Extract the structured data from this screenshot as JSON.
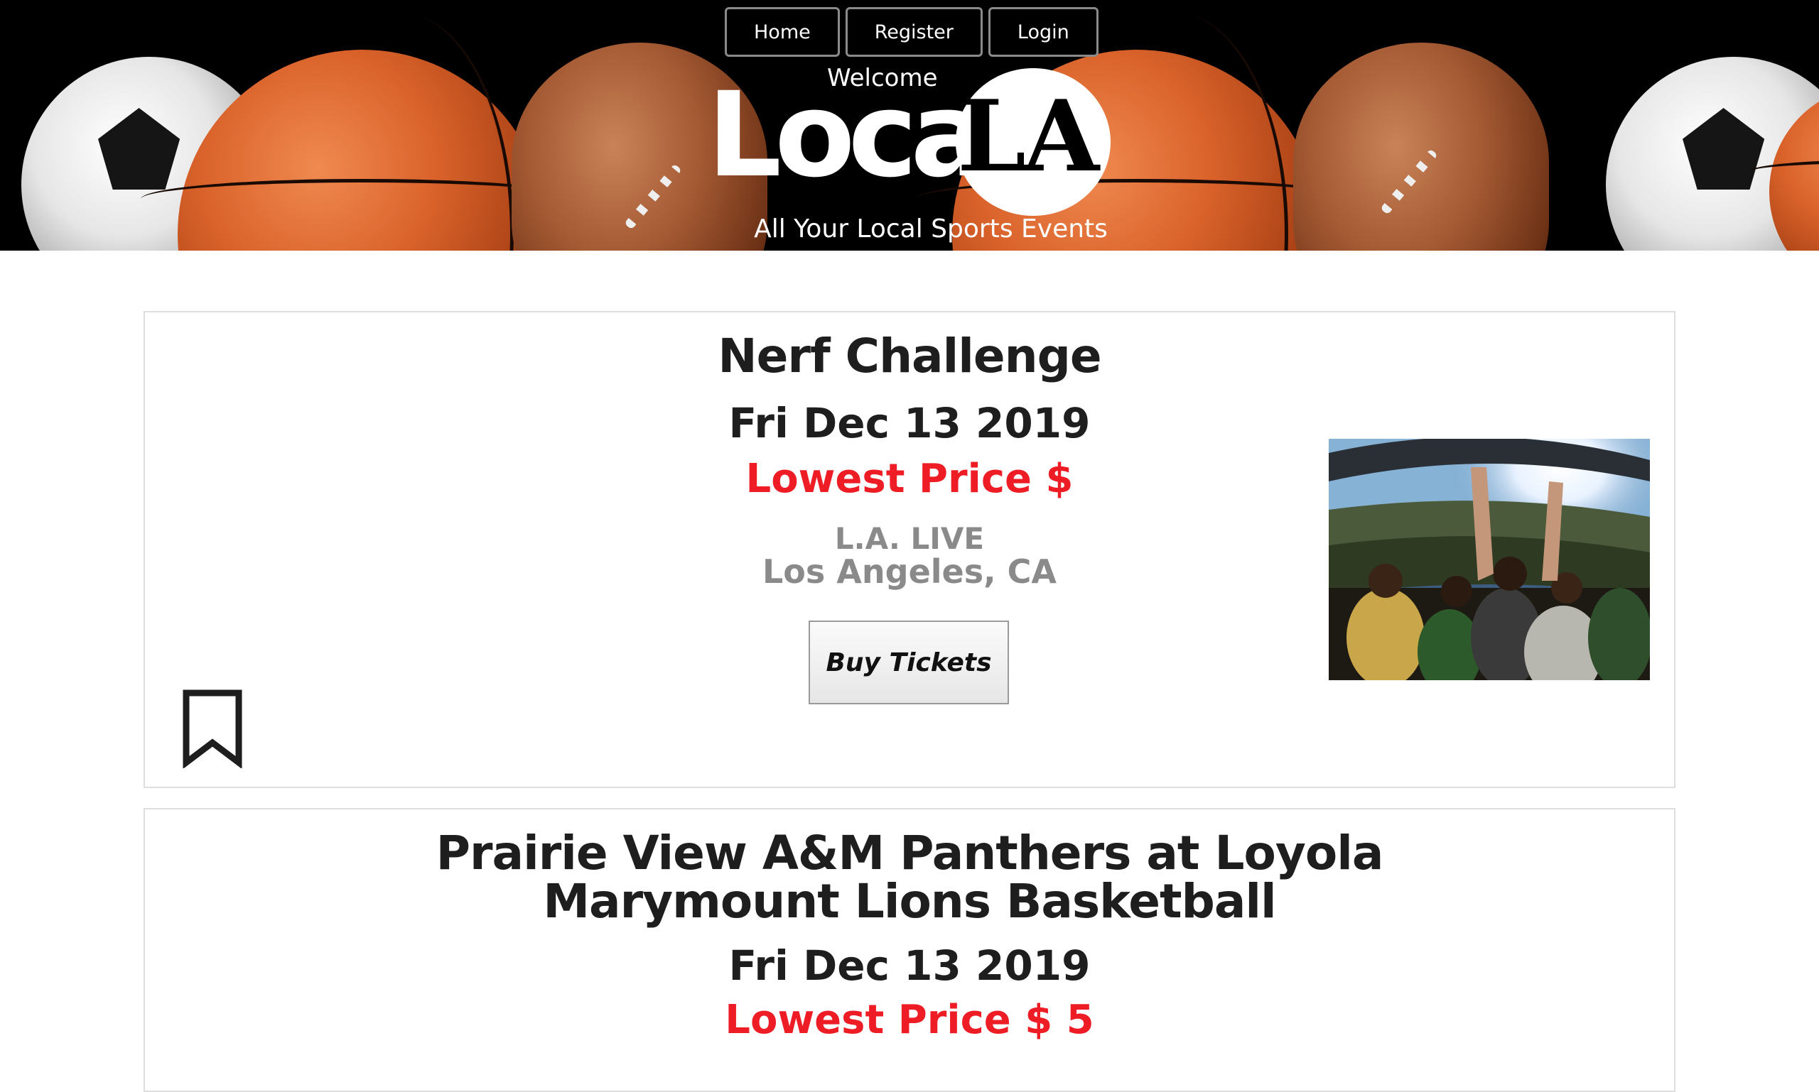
{
  "nav": {
    "home": "Home",
    "register": "Register",
    "login": "Login"
  },
  "hero": {
    "welcome": "Welcome",
    "logo_loca": "Loca",
    "logo_la": "LA",
    "tagline": "All Your Local Sports Events"
  },
  "events": [
    {
      "title": "Nerf Challenge",
      "date": "Fri Dec 13 2019",
      "price": "Lowest Price $",
      "venue_name": "L.A. LIVE",
      "venue_city": "Los Angeles, CA",
      "buy_label": "Buy Tickets",
      "bookmark_icon": "bookmark-icon",
      "image": "stadium-crowd-photo"
    },
    {
      "title_line1": "Prairie View A&M Panthers at Loyola",
      "title_line2": "Marymount Lions Basketball",
      "date": "Fri Dec 13 2019",
      "price": "Lowest Price $ 5"
    }
  ],
  "colors": {
    "price_red": "#ee1c25",
    "venue_gray": "#8a8a8a",
    "header_bg": "#000000"
  }
}
